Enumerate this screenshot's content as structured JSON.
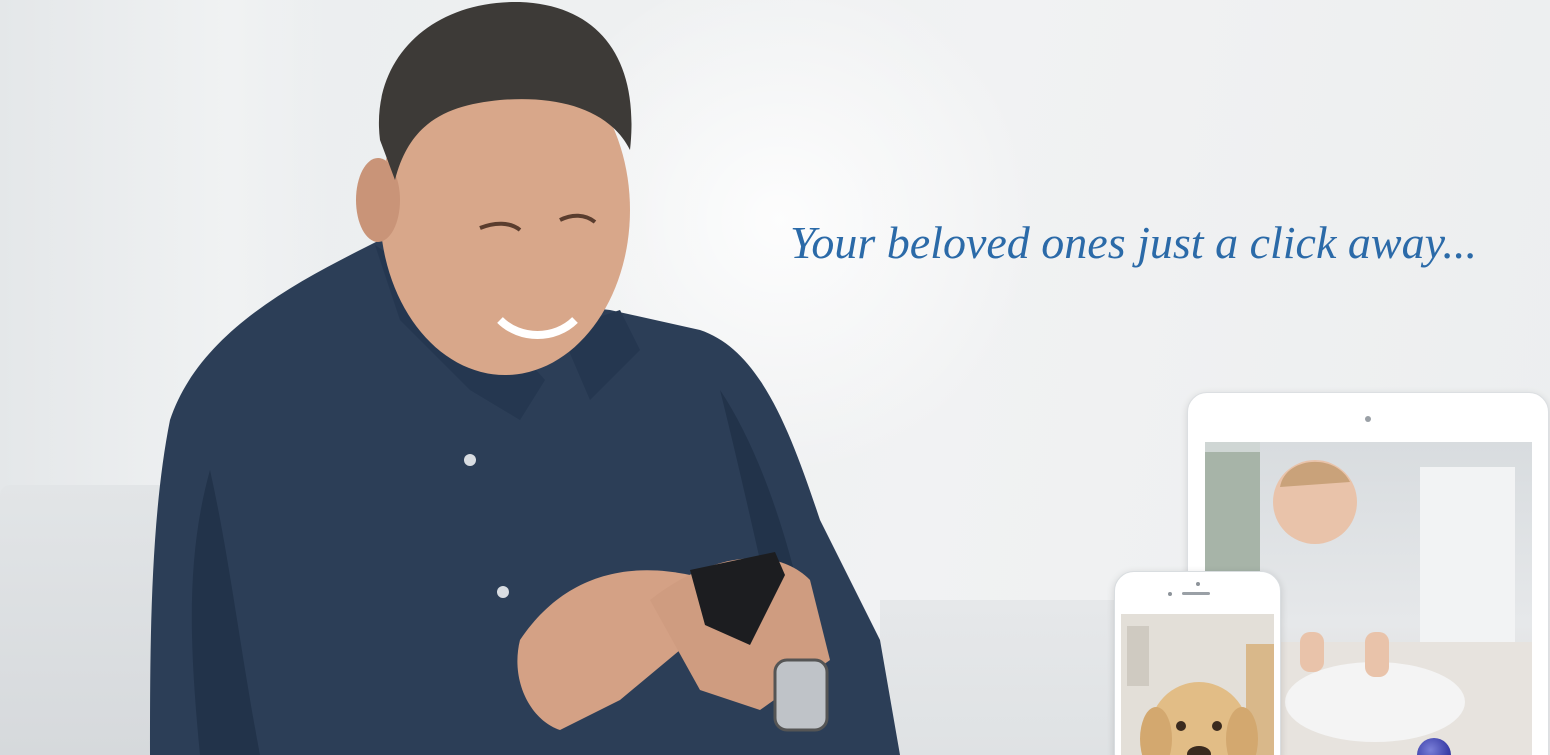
{
  "hero": {
    "tagline": "Your beloved ones just a click away..."
  },
  "colors": {
    "tagline": "#2b6aa8",
    "background": "#eceeef",
    "shirt": "#2c3e57",
    "device_frame": "#ffffff"
  },
  "images": {
    "person": "smiling man in dark blue shirt using a smartphone",
    "tablet_screen": "baby crawling on a carpet",
    "phone_screen": "golden retriever puppy"
  }
}
